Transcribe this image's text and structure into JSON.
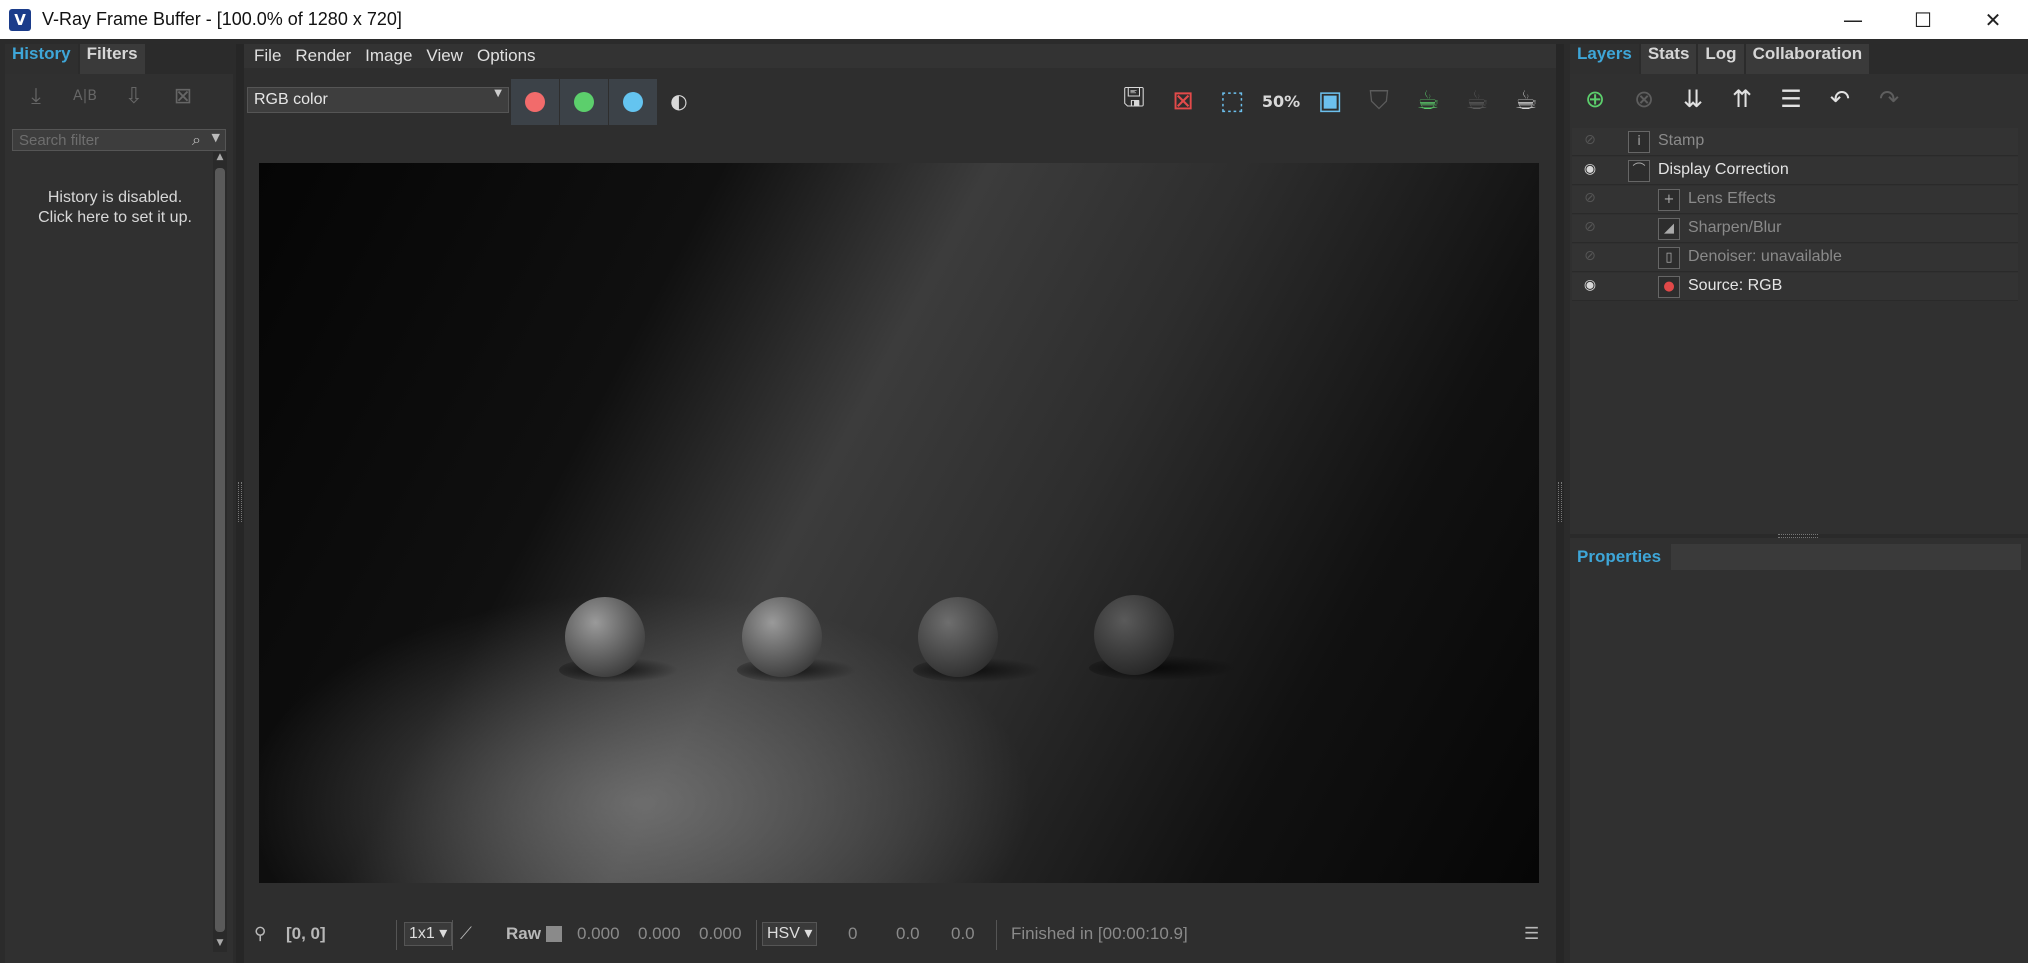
{
  "window": {
    "title": "V-Ray Frame Buffer - [100.0% of 1280 x 720]",
    "logo_glyph": "V",
    "minimize": "—",
    "maximize": "☐",
    "close": "✕"
  },
  "left_panel": {
    "tabs": [
      "History",
      "Filters"
    ],
    "active_tab": "History",
    "search_placeholder": "Search filter",
    "message_line1": "History is disabled.",
    "message_line2": "Click here to set it up."
  },
  "menu": [
    "File",
    "Render",
    "Image",
    "View",
    "Options"
  ],
  "toolbar": {
    "channel_select": "RGB color",
    "channel_colors": {
      "red": "#f26b6b",
      "green": "#5ccf6c",
      "blue": "#64c4f0"
    },
    "zoom_badge": "50%"
  },
  "status": {
    "coords": "[0, 0]",
    "sample_size": "1x1",
    "raw_label": "Raw",
    "rgb_values": [
      "0.000",
      "0.000",
      "0.000"
    ],
    "color_mode": "HSV",
    "hsv_values": [
      "0",
      "0.0",
      "0.0"
    ],
    "render_time": "Finished in [00:00:10.9]"
  },
  "right_panel": {
    "tabs": [
      "Layers",
      "Stats",
      "Log",
      "Collaboration"
    ],
    "active_tab": "Layers",
    "layers": [
      {
        "name": "Stamp",
        "visible": false,
        "enabled": false
      },
      {
        "name": "Display Correction",
        "visible": true,
        "enabled": true
      },
      {
        "name": "Lens Effects",
        "visible": false,
        "enabled": false
      },
      {
        "name": "Sharpen/Blur",
        "visible": false,
        "enabled": false
      },
      {
        "name": "Denoiser: unavailable",
        "visible": false,
        "enabled": false
      },
      {
        "name": "Source: RGB",
        "visible": true,
        "enabled": true
      }
    ],
    "properties_label": "Properties"
  },
  "colors": {
    "accent": "#3ea6d8",
    "background": "#2b2b2b"
  }
}
